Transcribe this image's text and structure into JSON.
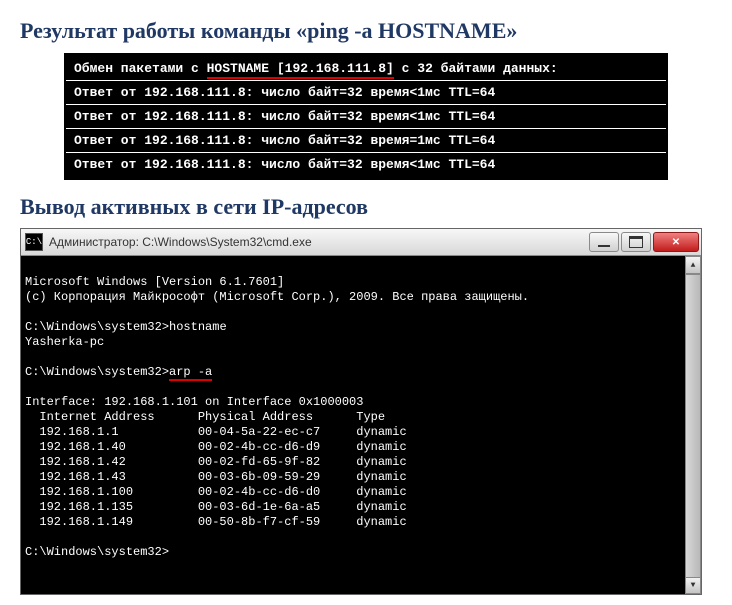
{
  "heading1": "Результат работы команды «ping -a HOSTNAME»",
  "ping": {
    "exchange_prefix": "Обмен пакетами с ",
    "exchange_host": "HOSTNAME [192.168.111.8]",
    "exchange_suffix": " с 32 байтами данных:",
    "replies": [
      "Ответ от 192.168.111.8: число байт=32 время<1мс TTL=64",
      "Ответ от 192.168.111.8: число байт=32 время<1мс TTL=64",
      "Ответ от 192.168.111.8: число байт=32 время=1мс TTL=64",
      "Ответ от 192.168.111.8: число байт=32 время<1мс TTL=64"
    ]
  },
  "heading2": "Вывод активных в сети IP-адресов",
  "cmd": {
    "title": "Администратор: C:\\Windows\\System32\\cmd.exe",
    "banner1": "Microsoft Windows [Version 6.1.7601]",
    "banner2": "(c) Корпорация Майкрософт (Microsoft Corp.), 2009. Все права защищены.",
    "prompt1_path": "C:\\Windows\\system32>",
    "prompt1_cmd": "hostname",
    "hostname_out": "Yasherka-pc",
    "prompt2_path": "C:\\Windows\\system32>",
    "prompt2_cmd": "arp -a",
    "arp_header": "Interface: 192.168.1.101 on Interface 0x1000003",
    "arp_cols": "  Internet Address      Physical Address      Type",
    "arp_rows": [
      "  192.168.1.1           00-04-5a-22-ec-c7     dynamic",
      "  192.168.1.40          00-02-4b-cc-d6-d9     dynamic",
      "  192.168.1.42          00-02-fd-65-9f-82     dynamic",
      "  192.168.1.43          00-03-6b-09-59-29     dynamic",
      "  192.168.1.100         00-02-4b-cc-d6-d0     dynamic",
      "  192.168.1.135         00-03-6d-1e-6a-a5     dynamic",
      "  192.168.1.149         00-50-8b-f7-cf-59     dynamic"
    ],
    "prompt3": "C:\\Windows\\system32>"
  }
}
